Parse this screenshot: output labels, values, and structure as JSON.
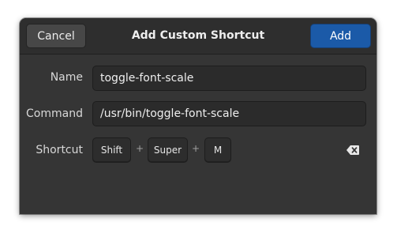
{
  "header": {
    "title": "Add Custom Shortcut",
    "cancel_label": "Cancel",
    "add_label": "Add"
  },
  "form": {
    "name_label": "Name",
    "name_value": "toggle-font-scale",
    "command_label": "Command",
    "command_value": "/usr/bin/toggle-font-scale",
    "shortcut_label": "Shortcut",
    "shortcut_keys": [
      "Shift",
      "Super",
      "M"
    ],
    "separator": "+",
    "clear_icon": "backspace-clear-icon"
  },
  "colors": {
    "accent": "#1b5aa8",
    "dialog_bg": "#353535",
    "headerbar_bg": "#2e2e2e"
  }
}
